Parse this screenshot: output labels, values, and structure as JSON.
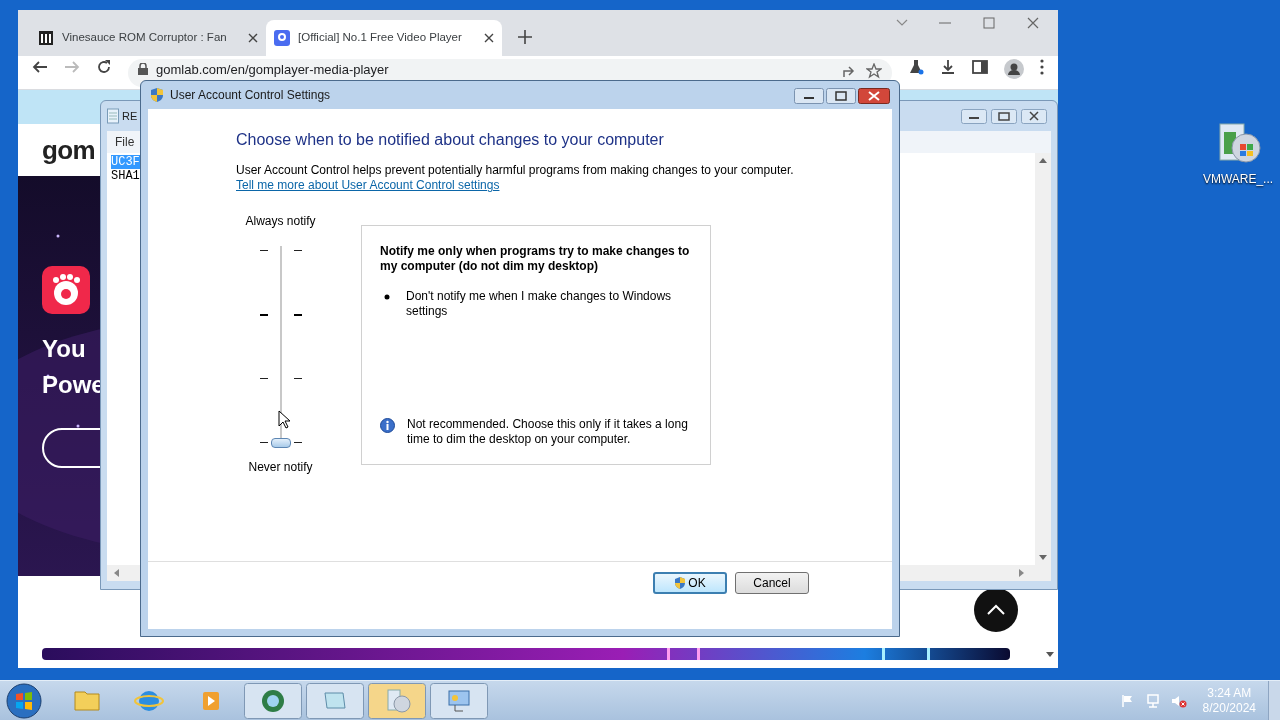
{
  "browser": {
    "tabs": [
      {
        "title": "Vinesauce ROM Corruptor : Fan",
        "selected": false
      },
      {
        "title": "[Official] No.1 Free Video Player",
        "selected": true
      }
    ],
    "address": "gomlab.com/en/gomplayer-media-player",
    "page": {
      "logo": "gom",
      "headline_lines": [
        "You",
        "Powe"
      ]
    }
  },
  "notepad": {
    "title": "RE",
    "menu": [
      "File"
    ],
    "lines": [
      {
        "text": "UC3F",
        "selected": true
      },
      {
        "text": "SHA1",
        "selected": false
      }
    ]
  },
  "dialog": {
    "title": "User Account Control Settings",
    "heading": "Choose when to be notified about changes to your computer",
    "description": "User Account Control helps prevent potentially harmful programs from making changes to your computer.",
    "link": "Tell me more about User Account Control settings",
    "slider": {
      "top_label": "Always notify",
      "bottom_label": "Never notify",
      "level": 0
    },
    "panel": {
      "title": "Notify me only when programs try to make changes to my computer (do not dim my desktop)",
      "bullets": [
        "Don't notify me when I make changes to Windows settings"
      ],
      "note": "Not recommended. Choose this only if it takes a long time to dim the desktop on your computer."
    },
    "buttons": [
      {
        "label": "OK",
        "default": true
      },
      {
        "label": "Cancel",
        "default": false
      }
    ]
  },
  "desktop_icons": [
    {
      "label": "VMWARE_..."
    }
  ],
  "taskbar": {
    "time": "3:24 AM",
    "date": "8/20/2024"
  }
}
